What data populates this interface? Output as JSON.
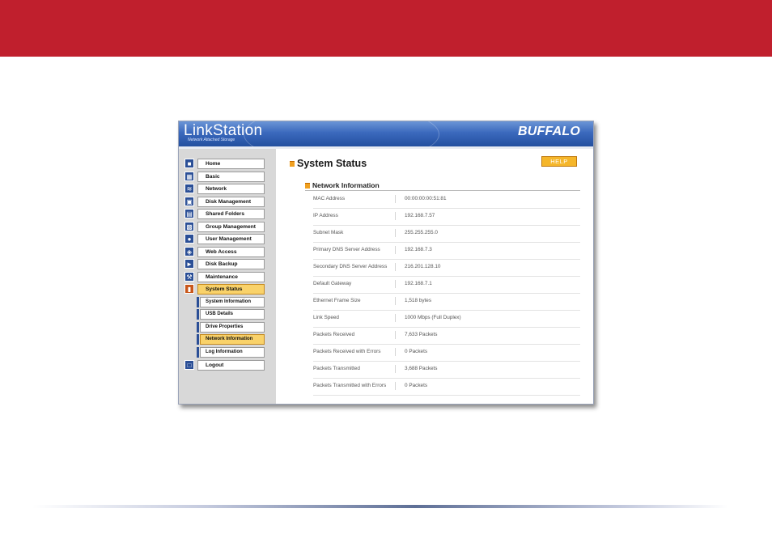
{
  "header": {
    "logo_text": "LinkStation",
    "logo_subtitle": "Network Attached Storage",
    "brand": "BUFFALO"
  },
  "sidebar": {
    "items": [
      {
        "label": "Home",
        "icon": "home-icon"
      },
      {
        "label": "Basic",
        "icon": "basic-settings-icon"
      },
      {
        "label": "Network",
        "icon": "network-icon"
      },
      {
        "label": "Disk Management",
        "icon": "disk-icon"
      },
      {
        "label": "Shared Folders",
        "icon": "folder-icon"
      },
      {
        "label": "Group Management",
        "icon": "group-icon"
      },
      {
        "label": "User Management",
        "icon": "user-icon"
      },
      {
        "label": "Web Access",
        "icon": "web-icon"
      },
      {
        "label": "Disk Backup",
        "icon": "backup-icon"
      },
      {
        "label": "Maintenance",
        "icon": "maintenance-icon"
      },
      {
        "label": "System Status",
        "icon": "status-icon",
        "active": true
      },
      {
        "label": "Logout",
        "icon": "logout-icon"
      }
    ],
    "sub_items": [
      {
        "label": "System Information"
      },
      {
        "label": "USB Details"
      },
      {
        "label": "Drive Properties"
      },
      {
        "label": "Network Information",
        "active": true
      },
      {
        "label": "Log Information"
      }
    ]
  },
  "main": {
    "title": "System Status",
    "help_label": "HELP",
    "section_title": "Network Information",
    "rows": [
      {
        "label": "MAC Address",
        "value": "00:00:00:00:51:81"
      },
      {
        "label": "IP Address",
        "value": "192.168.7.57"
      },
      {
        "label": "Subnet Mask",
        "value": "255.255.255.0"
      },
      {
        "label": "Primary DNS Server Address",
        "value": "192.168.7.3"
      },
      {
        "label": "Secondary DNS Server Address",
        "value": "216.201.128.10"
      },
      {
        "label": "Default Gateway",
        "value": "192.168.7.1"
      },
      {
        "label": "Ethernet Frame Size",
        "value": "1,518 bytes"
      },
      {
        "label": "Link Speed",
        "value": "1000 Mbps (Full Duplex)"
      },
      {
        "label": "Packets Received",
        "value": "7,633 Packets"
      },
      {
        "label": "Packets Received with Errors",
        "value": "0 Packets"
      },
      {
        "label": "Packets Transmitted",
        "value": "3,688 Packets"
      },
      {
        "label": "Packets Transmitted with Errors",
        "value": "0 Packets"
      }
    ]
  },
  "colors": {
    "banner": "#c01f2d",
    "header_blue": "#3b69bd",
    "active_yellow": "#f9d26a",
    "help_orange": "#f5b62a"
  }
}
